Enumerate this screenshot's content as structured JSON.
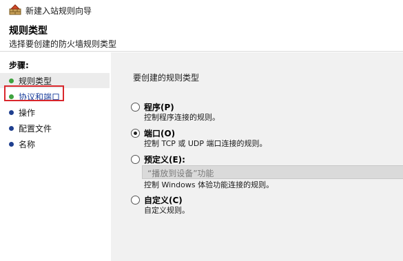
{
  "window": {
    "title": "新建入站规则向导",
    "icon": "firewall-wizard-icon"
  },
  "header": {
    "title": "规则类型",
    "subtitle": "选择要创建的防火墙规则类型"
  },
  "sidebar": {
    "heading": "步骤:",
    "items": [
      {
        "label": "规则类型",
        "dot_color": "#3fa33f",
        "label_color": "#1a1a1a"
      },
      {
        "label": "协议和端口",
        "dot_color": "#3fa33f",
        "label_color": "#1a3f9c"
      },
      {
        "label": "操作",
        "dot_color": "#1f3f8f",
        "label_color": "#1a1a1a"
      },
      {
        "label": "配置文件",
        "dot_color": "#1f3f8f",
        "label_color": "#1a1a1a"
      },
      {
        "label": "名称",
        "dot_color": "#1f3f8f",
        "label_color": "#1a1a1a"
      }
    ],
    "highlight_color": "#d9262b"
  },
  "content": {
    "heading": "要创建的规则类型",
    "options": [
      {
        "label": "程序(P)",
        "description": "控制程序连接的规则。",
        "selected": false
      },
      {
        "label": "端口(O)",
        "description": "控制 TCP 或 UDP 端口连接的规则。",
        "selected": true
      },
      {
        "label": "预定义(E):",
        "description": "控制 Windows 体验功能连接的规则。",
        "selected": false
      },
      {
        "label": "自定义(C)",
        "description": "自定义规则。",
        "selected": false
      }
    ],
    "predefined_value": "“播放到设备”功能"
  }
}
